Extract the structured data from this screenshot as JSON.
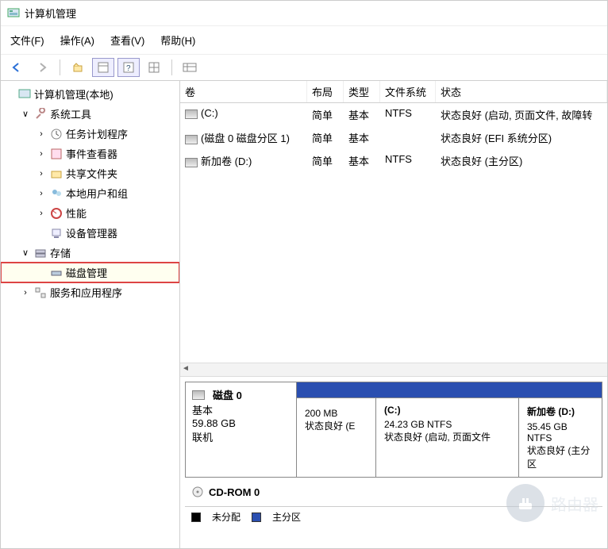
{
  "window": {
    "title": "计算机管理"
  },
  "menubar": {
    "file": "文件(F)",
    "action": "操作(A)",
    "view": "查看(V)",
    "help": "帮助(H)"
  },
  "tree": {
    "root": "计算机管理(本地)",
    "system_tools": "系统工具",
    "task_scheduler": "任务计划程序",
    "event_viewer": "事件查看器",
    "shared_folders": "共享文件夹",
    "local_users": "本地用户和组",
    "performance": "性能",
    "device_manager": "设备管理器",
    "storage": "存储",
    "disk_mgmt": "磁盘管理",
    "services_apps": "服务和应用程序"
  },
  "columns": [
    "卷",
    "布局",
    "类型",
    "文件系统",
    "状态"
  ],
  "volumes": [
    {
      "name": "(C:)",
      "layout": "简单",
      "type": "基本",
      "fs": "NTFS",
      "status": "状态良好 (启动, 页面文件, 故障转"
    },
    {
      "name": "(磁盘 0 磁盘分区 1)",
      "layout": "简单",
      "type": "基本",
      "fs": "",
      "status": "状态良好 (EFI 系统分区)"
    },
    {
      "name": "新加卷 (D:)",
      "layout": "简单",
      "type": "基本",
      "fs": "NTFS",
      "status": "状态良好 (主分区)"
    }
  ],
  "disk0": {
    "label": "磁盘 0",
    "type": "基本",
    "size": "59.88 GB",
    "status": "联机",
    "parts": [
      {
        "name": "",
        "size": "200 MB",
        "status": "状态良好 (E"
      },
      {
        "name": "(C:)",
        "size": "24.23 GB NTFS",
        "status": "状态良好 (启动, 页面文件"
      },
      {
        "name": "新加卷  (D:)",
        "size": "35.45 GB NTFS",
        "status": "状态良好 (主分区"
      }
    ]
  },
  "cdrom": "CD-ROM 0",
  "legend": {
    "unalloc": "未分配",
    "primary": "主分区"
  },
  "watermark": "路由器"
}
